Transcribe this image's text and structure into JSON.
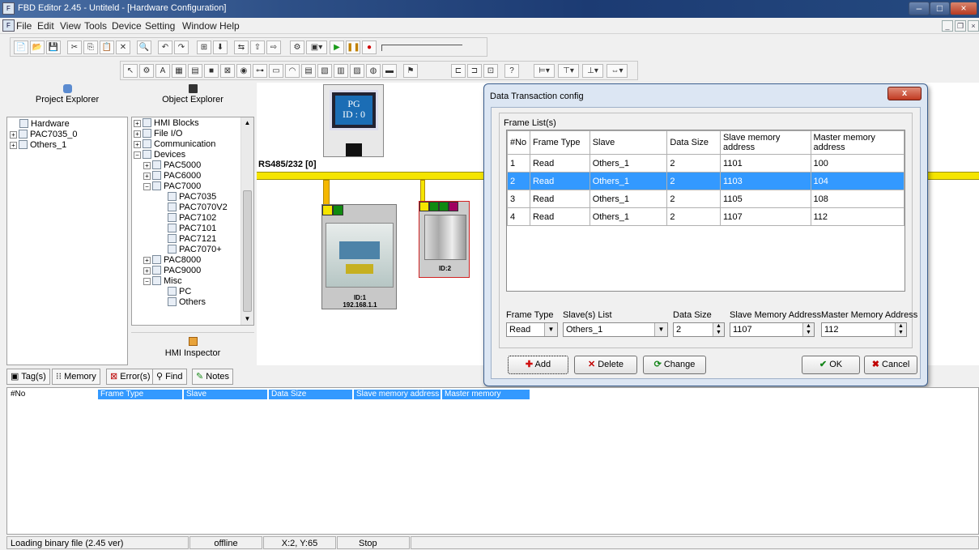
{
  "window": {
    "title": "FBD Editor 2.45 - Untiteld - [Hardware Configuration]"
  },
  "menu": [
    "File",
    "Edit",
    "View",
    "Tools",
    "Device",
    "Setting",
    "Window",
    "Help"
  ],
  "project_explorer": {
    "title": "Project Explorer",
    "items": [
      "Hardware",
      "PAC7035_0",
      "Others_1"
    ]
  },
  "object_explorer": {
    "title": "Object Explorer",
    "items": [
      "HMI Blocks",
      "File I/O",
      "Communication",
      "Devices",
      "PAC5000",
      "PAC6000",
      "PAC7000",
      "PAC7035",
      "PAC7070V2",
      "PAC7102",
      "PAC7101",
      "PAC7121",
      "PAC7070+",
      "PAC8000",
      "PAC9000",
      "Misc",
      "PC",
      "Others"
    ]
  },
  "hmi_inspector": {
    "title": "HMI Inspector"
  },
  "canvas": {
    "pg_label_line1": "PG",
    "pg_label_line2": "ID : 0",
    "bus_label": "RS485/232 [0]",
    "device1_id": "ID:1",
    "device1_ip": "192.168.1.1",
    "device2_id": "ID:2"
  },
  "dialog": {
    "title": "Data Transaction config",
    "close": "x",
    "frame_list_label": "Frame List(s)",
    "columns": [
      "#No",
      "Frame Type",
      "Slave",
      "Data Size",
      "Slave memory address",
      "Master memory address"
    ],
    "rows": [
      [
        "1",
        "Read",
        "Others_1",
        "2",
        "1101",
        "100"
      ],
      [
        "2",
        "Read",
        "Others_1",
        "2",
        "1103",
        "104"
      ],
      [
        "3",
        "Read",
        "Others_1",
        "2",
        "1105",
        "108"
      ],
      [
        "4",
        "Read",
        "Others_1",
        "2",
        "1107",
        "112"
      ]
    ],
    "selected_row": 1,
    "form": {
      "frame_type_label": "Frame Type",
      "frame_type_value": "Read",
      "slave_list_label": "Slave(s) List",
      "slave_list_value": "Others_1",
      "data_size_label": "Data Size",
      "data_size_value": "2",
      "slave_addr_label": "Slave Memory Address",
      "slave_addr_value": "1107",
      "master_addr_label": "Master Memory Address",
      "master_addr_value": "112"
    },
    "buttons": {
      "add": "Add",
      "delete": "Delete",
      "change": "Change",
      "ok": "OK",
      "cancel": "Cancel"
    }
  },
  "bottom_tabs": [
    "Tag(s)",
    "Memory",
    "Error(s)",
    "Find",
    "Notes"
  ],
  "bottom_columns": [
    "#No",
    "Frame Type",
    "Slave",
    "Data Size",
    "Slave memory address",
    "Master memory address"
  ],
  "status": {
    "message": "Loading binary file (2.45 ver)",
    "mode": "offline",
    "coords": "X:2, Y:65",
    "state": "Stop"
  }
}
